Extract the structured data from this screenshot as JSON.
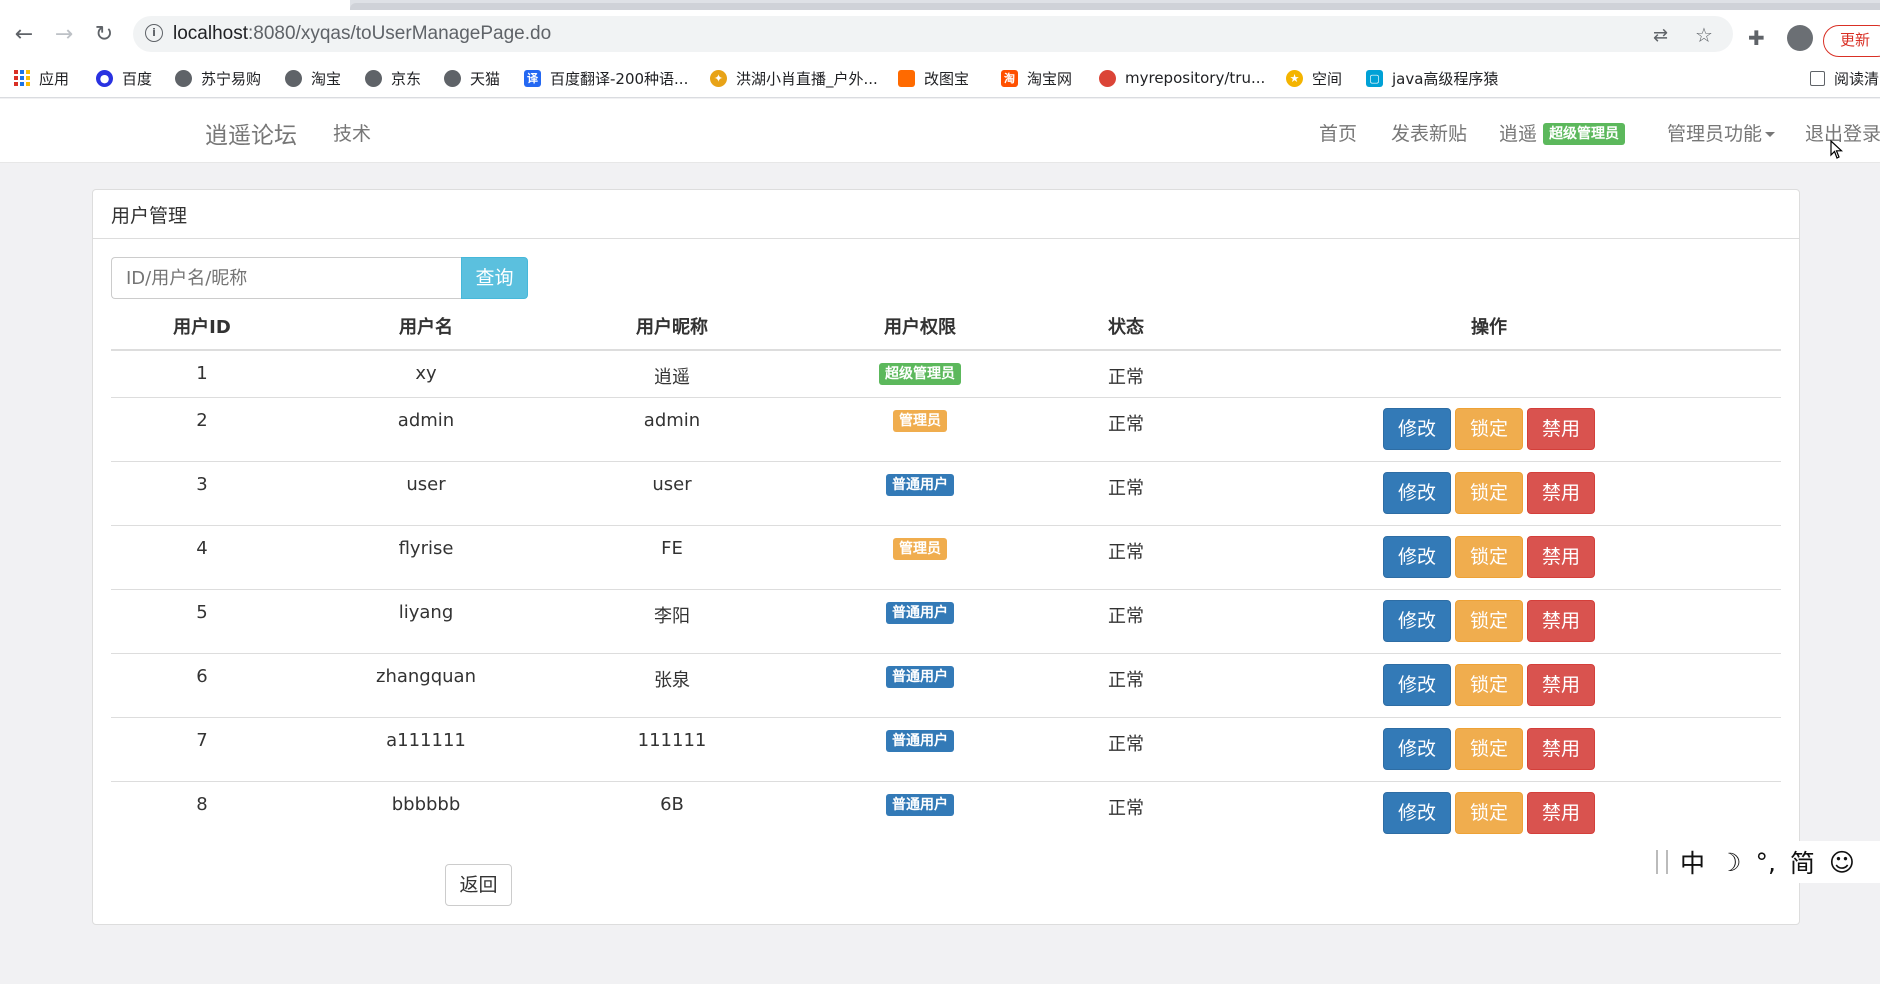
{
  "browser": {
    "url_host": "localhost",
    "url_rest": ":8080/xyqas/toUserManagePage.do",
    "update_label": "更新"
  },
  "bookmarks": [
    {
      "label": "应用"
    },
    {
      "label": "百度"
    },
    {
      "label": "苏宁易购"
    },
    {
      "label": "淘宝"
    },
    {
      "label": "京东"
    },
    {
      "label": "天猫"
    },
    {
      "label": "百度翻译-200种语..."
    },
    {
      "label": "洪湖小肖直播_户外..."
    },
    {
      "label": "改图宝"
    },
    {
      "label": "淘宝网"
    },
    {
      "label": "myrepository/tru..."
    },
    {
      "label": "空间"
    },
    {
      "label": "java高级程序猿"
    },
    {
      "label": "阅读清"
    }
  ],
  "navbar": {
    "brand": "逍遥论坛",
    "tech": "技术",
    "home": "首页",
    "new_post": "发表新贴",
    "username": "逍遥",
    "user_badge": "超级管理员",
    "admin_menu": "管理员功能",
    "logout": "退出登录"
  },
  "panel": {
    "title": "用户管理",
    "search_placeholder": "ID/用户名/昵称",
    "search_button": "查询",
    "back_button": "返回"
  },
  "table": {
    "headers": [
      "用户ID",
      "用户名",
      "用户昵称",
      "用户权限",
      "状态",
      "操作"
    ],
    "actions": {
      "edit": "修改",
      "lock": "锁定",
      "ban": "禁用"
    },
    "rows": [
      {
        "id": "1",
        "username": "xy",
        "nickname": "逍遥",
        "role": "超级管理员",
        "status": "正常"
      },
      {
        "id": "2",
        "username": "admin",
        "nickname": "admin",
        "role": "管理员",
        "status": "正常"
      },
      {
        "id": "3",
        "username": "user",
        "nickname": "user",
        "role": "普通用户",
        "status": "正常"
      },
      {
        "id": "4",
        "username": "flyrise",
        "nickname": "FE",
        "role": "管理员",
        "status": "正常"
      },
      {
        "id": "5",
        "username": "liyang",
        "nickname": "李阳",
        "role": "普通用户",
        "status": "正常"
      },
      {
        "id": "6",
        "username": "zhangquan",
        "nickname": "张泉",
        "role": "普通用户",
        "status": "正常"
      },
      {
        "id": "7",
        "username": "a111111",
        "nickname": "111111",
        "role": "普通用户",
        "status": "正常"
      },
      {
        "id": "8",
        "username": "bbbbbb",
        "nickname": "6B",
        "role": "普通用户",
        "status": "正常"
      }
    ]
  },
  "ime": {
    "lang": "中",
    "moon": "☽",
    "punct": "°,",
    "script": "简",
    "emoji": "☺"
  },
  "colors": {
    "super_admin": "#5cb85c",
    "admin": "#f0ad4e",
    "user": "#337ab7",
    "primary": "#337ab7",
    "warning": "#f0ad4e",
    "danger": "#d9534f",
    "info": "#5bc0de"
  }
}
